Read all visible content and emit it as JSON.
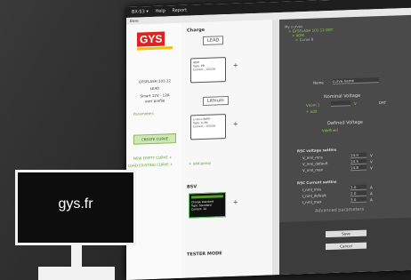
{
  "app": {
    "menu": "BX-S3 ▾",
    "help": "Help",
    "report": "Report"
  },
  "tabs": {
    "main": "Base"
  },
  "sidebar": {
    "brand": "GYS",
    "device": [
      "GYSFLASH 101-12",
      "LEAD",
      "Smart 12V - 12A",
      "user profile"
    ],
    "settings_label": "Parameters",
    "create_button": "CREATE CURVE",
    "links": [
      "NEW EMPTY CURVE +",
      "LOAD EXISTING CURVE +"
    ]
  },
  "center": {
    "charge_title": "Charge",
    "lead_label": "LEAD",
    "card1": {
      "name": "AGM",
      "lines": [
        "Type: PB",
        "Current : 12/12A"
      ]
    },
    "lithium_label": "Lithium",
    "card2": {
      "name": "Li-Ion-LiFePO",
      "lines": [
        "Type: Li-Mo",
        "Current : 15/15A"
      ]
    },
    "add_group": "+ add group",
    "bsv_title": "BSV",
    "bsv_card": {
      "name": "Charge standard",
      "lines": [
        "Type: Standard",
        "Current: 1A"
      ]
    },
    "tester_title": "TESTER MODE"
  },
  "panel": {
    "breadcrumb": [
      "My curves",
      "> GYSFLASH 101-12 DRT",
      "> AGM",
      "> Curve 8"
    ],
    "name_label": "Name",
    "name_value": "curve-name",
    "nominal_title": "Nominal Voltage",
    "nominal_row": {
      "label": "Vnom 1",
      "unit": "V",
      "unit2": "DRT"
    },
    "nominal_sub": "+ add",
    "defined_title": "Defined Voltage",
    "defined_row": "Vdefined",
    "rsc_voltage_title": "RSC voltage settins",
    "voltage_rows": [
      {
        "label": "V_nml_mns",
        "value": "14.0",
        "unit": "V"
      },
      {
        "label": "V_nml_default",
        "value": "14.5",
        "unit": "V"
      },
      {
        "label": "V_nml_max",
        "value": "14.8",
        "unit": "V"
      }
    ],
    "rsc_current_title": "RSC Current settins",
    "current_rows": [
      {
        "label": "I_nml_mns",
        "value": "1.0",
        "unit": "A"
      },
      {
        "label": "I_nml_default",
        "value": "2.0",
        "unit": "A"
      },
      {
        "label": "I_nml_max",
        "value": "3.0",
        "unit": "A"
      }
    ],
    "advanced": "Advanced parameters",
    "save_button": "Save",
    "cancel_button": "Cancel"
  },
  "overlay": {
    "domain": "gys.fr"
  }
}
